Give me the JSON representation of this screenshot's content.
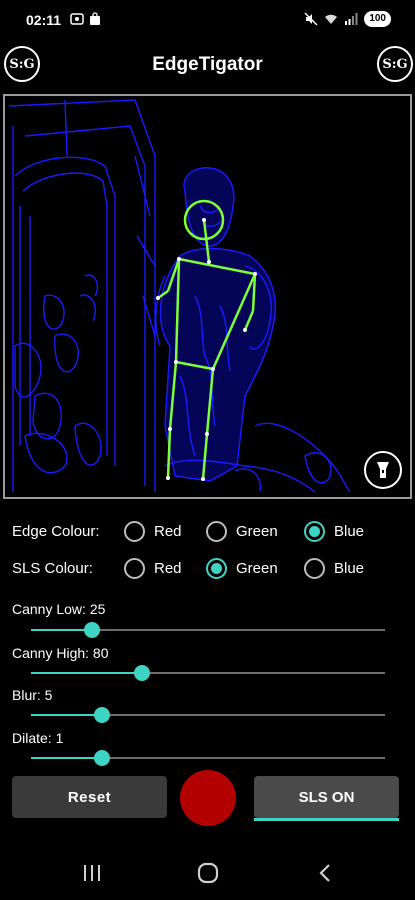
{
  "status_bar": {
    "time": "02:11",
    "battery": "100"
  },
  "app_bar": {
    "title": "EdgeTigator",
    "logo_text": "S:G"
  },
  "edge_colour": {
    "label": "Edge Colour:",
    "options": [
      "Red",
      "Green",
      "Blue"
    ],
    "selected": "Blue"
  },
  "sls_colour": {
    "label": "SLS Colour:",
    "options": [
      "Red",
      "Green",
      "Blue"
    ],
    "selected": "Green"
  },
  "sliders": {
    "canny_low": {
      "label": "Canny Low: 25",
      "value": 25,
      "max": 255
    },
    "canny_high": {
      "label": "Canny High: 80",
      "value": 80,
      "max": 255
    },
    "blur": {
      "label": "Blur: 5",
      "value": 5,
      "max": 25
    },
    "dilate": {
      "label": "Dilate: 1",
      "value": 1,
      "max": 5
    }
  },
  "buttons": {
    "reset": "Reset",
    "sls": "SLS ON"
  },
  "colors": {
    "accent": "#3fd3c4",
    "edge": "#1a1aff",
    "skeleton": "#7cff3a",
    "record": "#b30000"
  },
  "icons": {
    "torch": "flashlight-icon",
    "nav_recents": "recents-icon",
    "nav_home": "home-icon",
    "nav_back": "back-icon"
  }
}
